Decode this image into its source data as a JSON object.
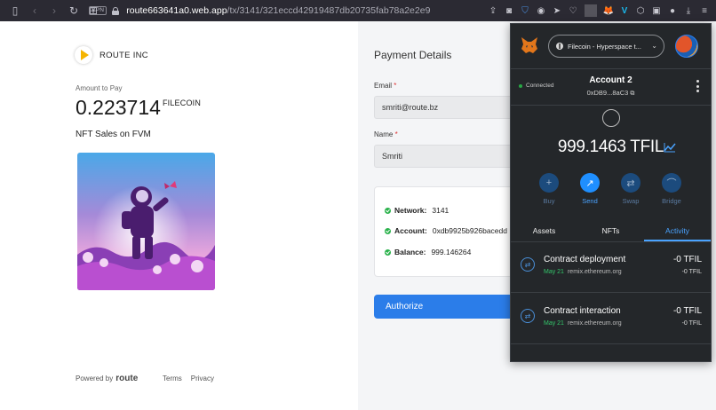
{
  "browser": {
    "vpn": "VPN",
    "url_host": "route663641a0.web.app",
    "url_path": "/tx/3141/321eccd42919487db20735fab78a2e2e9"
  },
  "checkout": {
    "company": "ROUTE INC",
    "amount_label": "Amount to Pay",
    "amount": "0.223714",
    "currency": "FILECOIN",
    "nft_title": "NFT Sales on FVM",
    "powered_by": "Powered by",
    "brand": "route",
    "terms": "Terms",
    "privacy": "Privacy"
  },
  "payment": {
    "title": "Payment Details",
    "email_label": "Email",
    "email_value": "smriti@route.bz",
    "name_label": "Name",
    "name_value": "Smriti",
    "required_mark": "*",
    "network_label": "Network:",
    "network_value": "3141",
    "account_label": "Account:",
    "account_value": "0xdb9925b926bacedd",
    "balance_label": "Balance:",
    "balance_value": "999.146264",
    "authorize_label": "Authorize"
  },
  "metamask": {
    "network": "Filecoin - Hyperspace t...",
    "connected": "Connected",
    "account_name": "Account 2",
    "account_address": "0xDB9...8aC3",
    "balance": "999.1463 TFIL",
    "actions": [
      "Buy",
      "Send",
      "Swap",
      "Bridge"
    ],
    "tabs": [
      "Assets",
      "NFTs",
      "Activity"
    ],
    "transactions": [
      {
        "name": "Contract deployment",
        "date": "May 21",
        "origin": "remix.ethereum.org",
        "amount": "-0 TFIL",
        "amount_sub": "-0 TFIL"
      },
      {
        "name": "Contract interaction",
        "date": "May 21",
        "origin": "remix.ethereum.org",
        "amount": "-0 TFIL",
        "amount_sub": "-0 TFIL"
      }
    ],
    "colors": {
      "background": "#24272a",
      "accent": "#1f8fff",
      "success": "#34c56a"
    }
  }
}
